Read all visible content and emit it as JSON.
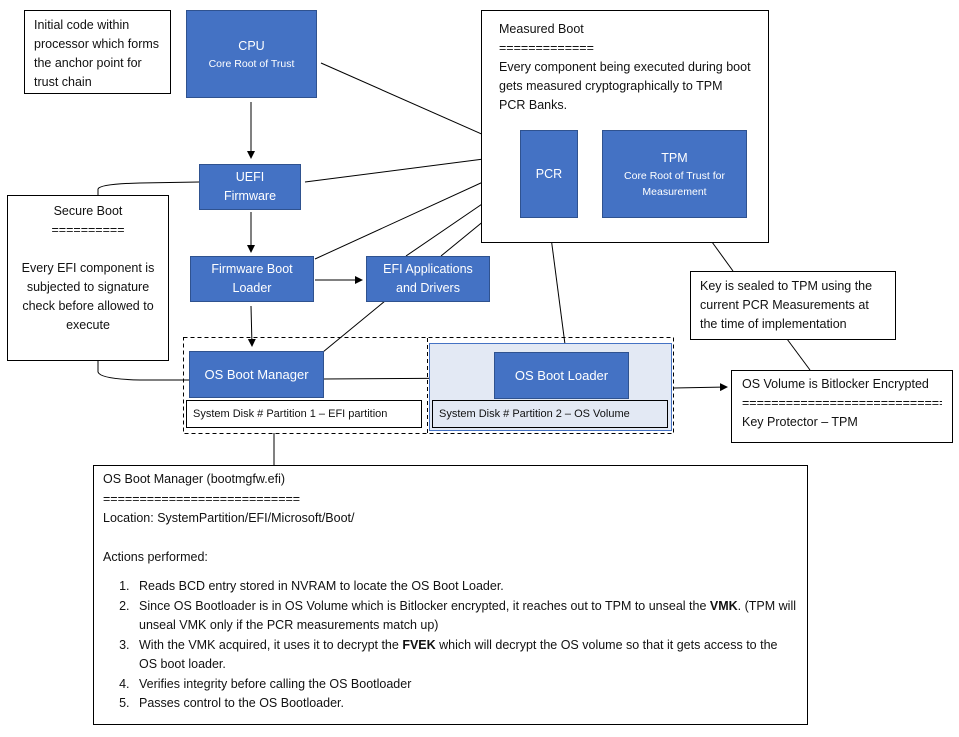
{
  "anchor_note": "Initial code within processor which forms the anchor point for trust chain",
  "cpu": {
    "title": "CPU",
    "subtitle": "Core Root of Trust"
  },
  "uefi": {
    "line1": "UEFI",
    "line2": "Firmware"
  },
  "firmware_boot_loader": {
    "line1": "Firmware Boot",
    "line2": "Loader"
  },
  "efi_apps": {
    "line1": "EFI Applications",
    "line2": "and Drivers"
  },
  "secure_boot": {
    "title": "Secure Boot",
    "rule": "==========",
    "body": "Every EFI component is subjected to signature check before allowed to execute"
  },
  "measured_boot": {
    "title": "Measured Boot",
    "rule": "=============",
    "body": "Every component being executed during boot gets measured cryptographically to TPM PCR Banks."
  },
  "pcr": "PCR",
  "tpm": {
    "title": "TPM",
    "subtitle": "Core Root of  Trust for Measurement"
  },
  "os_boot_manager": "OS Boot Manager",
  "os_boot_loader": "OS Boot Loader",
  "partition1": "System Disk # Partition 1 – EFI partition",
  "partition2": "System Disk # Partition 2 – OS Volume",
  "key_sealed_note": "Key is sealed to TPM using the current PCR Measurements at the time of implementation",
  "os_volume": {
    "title": "OS Volume is Bitlocker Encrypted",
    "rule": "============================",
    "body": "Key Protector – TPM"
  },
  "bootmgr_details": {
    "title": "OS Boot Manager (bootmgfw.efi)",
    "rule": "===========================",
    "location": "Location: SystemPartition/EFI/Microsoft/Boot/",
    "actions_heading": "Actions performed:",
    "actions": [
      {
        "text": "Reads BCD entry stored in NVRAM to locate the OS Boot Loader."
      },
      {
        "pre": "Since OS Bootloader is in OS Volume which is Bitlocker encrypted, it reaches out to TPM to unseal the ",
        "bold": "VMK",
        "post": ". (TPM will unseal VMK only if the PCR measurements match up)"
      },
      {
        "pre": "With the VMK acquired, it uses it to decrypt the ",
        "bold": "FVEK",
        "post": " which will decrypt the OS volume so that it gets access to the OS boot loader."
      },
      {
        "text": "Verifies integrity before calling the OS Bootloader"
      },
      {
        "text": "Passes control to the OS Bootloader."
      }
    ]
  },
  "colors": {
    "box_fill": "#4472C4",
    "box_border": "#2F528F",
    "partition2_fill": "#E3E9F4"
  }
}
